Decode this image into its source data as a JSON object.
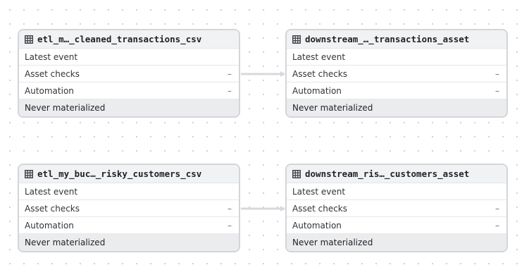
{
  "colors": {
    "node_border": "#d3d5d9",
    "header_bg": "#f1f2f4",
    "footer_bg": "#ebecee",
    "edge": "#d7d8dc",
    "text": "#1f2125"
  },
  "nodes": [
    {
      "icon": "table-icon",
      "title": "etl_m…_cleaned_transactions_csv",
      "rows": [
        {
          "label": "Latest event",
          "value": ""
        },
        {
          "label": "Asset checks",
          "value": "–"
        },
        {
          "label": "Automation",
          "value": "–"
        }
      ],
      "status": "Never materialized"
    },
    {
      "icon": "table-icon",
      "title": "downstream_…_transactions_asset",
      "rows": [
        {
          "label": "Latest event",
          "value": ""
        },
        {
          "label": "Asset checks",
          "value": "–"
        },
        {
          "label": "Automation",
          "value": "–"
        }
      ],
      "status": "Never materialized"
    },
    {
      "icon": "table-icon",
      "title": "etl_my_buc…_risky_customers_csv",
      "rows": [
        {
          "label": "Latest event",
          "value": ""
        },
        {
          "label": "Asset checks",
          "value": "–"
        },
        {
          "label": "Automation",
          "value": "–"
        }
      ],
      "status": "Never materialized"
    },
    {
      "icon": "table-icon",
      "title": "downstream_ris…_customers_asset",
      "rows": [
        {
          "label": "Latest event",
          "value": ""
        },
        {
          "label": "Asset checks",
          "value": "–"
        },
        {
          "label": "Automation",
          "value": "–"
        }
      ],
      "status": "Never materialized"
    }
  ]
}
